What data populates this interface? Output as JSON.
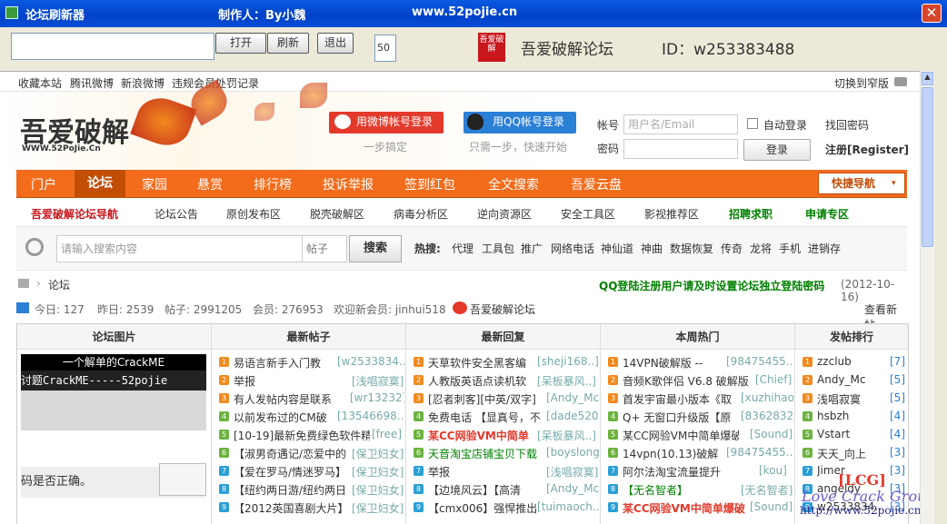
{
  "window": {
    "title": "论坛刷新器",
    "author": "制作人：By小魏",
    "site": "www.52pojie.cn",
    "close_label": "✕"
  },
  "toolbar": {
    "url_value": "",
    "open_label": "打开",
    "refresh_label": "刷新",
    "exit_label": "退出",
    "interval_value": "50",
    "logo_text": "吾爱破解",
    "forum_name": "吾爱破解论坛",
    "user_id": "ID：w253383488"
  },
  "topbar": {
    "links": [
      "收藏本站",
      "腾讯微博",
      "新浪微博",
      "违规会员处罚记录"
    ],
    "switch_label": "切换到窄版"
  },
  "header": {
    "logo_text": "吾爱破解",
    "logo_sub": "WWW.52PoJie.Cn",
    "weibo_login": "用微博帐号登录",
    "weibo_note": "一步搞定",
    "qq_login": "用QQ帐号登录",
    "qq_note": "只需一步，快速开始",
    "account_label": "帐号",
    "account_placeholder": "用户名/Email",
    "autologin_label": "自动登录",
    "forgot_label": "找回密码",
    "password_label": "密码",
    "login_button": "登录",
    "register_label": "注册[Register]"
  },
  "nav": {
    "items": [
      "门户",
      "论坛",
      "家园",
      "悬赏",
      "排行榜",
      "投诉举报",
      "签到红包",
      "全文搜索",
      "吾爱云盘"
    ],
    "quick_nav": "快捷导航"
  },
  "subnav": {
    "items": [
      "吾爱破解论坛导航",
      "论坛公告",
      "原创发布区",
      "脱壳破解区",
      "病毒分析区",
      "逆向资源区",
      "安全工具区",
      "影视推荐区",
      "招聘求职",
      "申请专区"
    ]
  },
  "search": {
    "placeholder": "请输入搜索内容",
    "scope": "帖子",
    "button": "搜索",
    "hot_label": "热搜:",
    "hot_terms": [
      "代理",
      "工具包",
      "推广",
      "网络电话",
      "神仙道",
      "神曲",
      "数据恢复",
      "传奇",
      "龙将",
      "手机",
      "进销存"
    ]
  },
  "crumbs": {
    "forum": "论坛",
    "notice": "QQ登陆注册用户请及时设置论坛独立登陆密码",
    "notice_date": "(2012-10-16)"
  },
  "stats": {
    "today": "今日: 127",
    "yesterday": "昨日: 2539",
    "posts": "帖子: 2991205",
    "members": "会员: 276953",
    "welcome": "欢迎新会员: jinhui518",
    "forum_link": "吾爱破解论坛",
    "new_posts": "查看新帖"
  },
  "board": {
    "headers": [
      "论坛图片",
      "最新帖子",
      "最新回复",
      "本周热门",
      "发帖排行"
    ],
    "image_caption": "一个解单的CrackME",
    "image_title": "讨题CrackME-----52pojie",
    "image_text": "码是否正确。",
    "latest_posts": [
      {
        "title": "易语言新手入门教",
        "author": "[w2533834..]"
      },
      {
        "title": "举报",
        "author": "[浅唱寂寞]"
      },
      {
        "title": "有人发帖内容是联系",
        "author": "[wr13232]"
      },
      {
        "title": "以前发布过的CM破",
        "author": "[13546698..]"
      },
      {
        "title": "[10-19]最新免费绿色软件精",
        "author": "[free]"
      },
      {
        "title": "【淑男奇遇记/恋爱中的",
        "author": "[保卫妇女]"
      },
      {
        "title": "【爱在罗马/情迷罗马】",
        "author": "[保卫妇女]"
      },
      {
        "title": "【纽约两日游/纽约两日",
        "author": "[保卫妇女]"
      },
      {
        "title": "【2012英国喜剧大片】",
        "author": "[保卫妇女]"
      }
    ],
    "latest_replies": [
      {
        "title": "天草软件安全黑客编",
        "author": "[sheji168..]"
      },
      {
        "title": "人教版英语点读机软",
        "author": "[呆板暴风..]"
      },
      {
        "title": "[忍者刺客][中英/双字]",
        "author": "[Andy_Mc]"
      },
      {
        "title": "免费电话 【显真号，不",
        "author": "[dade520]"
      },
      {
        "title": "某CC网验VM中简单",
        "author": "[呆板暴风..]"
      },
      {
        "title": "天音淘宝店铺宝贝下载",
        "author": "[boyslong]"
      },
      {
        "title": "举报",
        "author": "[浅唱寂寞]"
      },
      {
        "title": "【边境风云】【高清",
        "author": "[Andy_Mc]"
      },
      {
        "title": "【cmx006】强悍推出",
        "author": "[tuimaoch..]"
      }
    ],
    "weekly_hot": [
      {
        "title": "14VPN破解版 --",
        "author": "[98475455..]"
      },
      {
        "title": "音频K歌伴侣 V6.8 破解版",
        "author": "[Chief]"
      },
      {
        "title": "首发宇宙最小版本《取",
        "author": "[xuzhihao]"
      },
      {
        "title": "Q+ 无窗口升级版【原",
        "author": "[8362832]"
      },
      {
        "title": "某CC网验VM中简单爆破",
        "author": "[Sound]"
      },
      {
        "title": "14vpn(10.13)破解",
        "author": "[98475455..]"
      },
      {
        "title": "阿尔法淘宝流量提升",
        "author": "[kou]"
      },
      {
        "title": "【无名智者】",
        "author": "[无名智者]"
      },
      {
        "title": "某CC网验VM中简单爆破",
        "author": "[Sound]"
      }
    ],
    "ranking": [
      {
        "name": "zzclub",
        "count": "[7]"
      },
      {
        "name": "Andy_Mc",
        "count": "[5]"
      },
      {
        "name": "浅唱寂寞",
        "count": "[5]"
      },
      {
        "name": "hsbzh",
        "count": "[4]"
      },
      {
        "name": "Vstart",
        "count": "[4]"
      },
      {
        "name": "天天_向上",
        "count": "[3]"
      },
      {
        "name": "Jimer",
        "count": "[3]"
      },
      {
        "name": "angeldy",
        "count": "[3]"
      },
      {
        "name": "w2533834..",
        "count": "[3]"
      }
    ]
  },
  "watermark": {
    "tag": "[LCG]",
    "group": "Love Crack Group",
    "url": "http://www.52pojie.cn"
  },
  "colors": {
    "title_bar": "#0041c8",
    "nav_orange": "#f26c1c",
    "nav_active": "#c24d05",
    "brand_red": "#c8161d",
    "highlight_green": "#008000"
  }
}
